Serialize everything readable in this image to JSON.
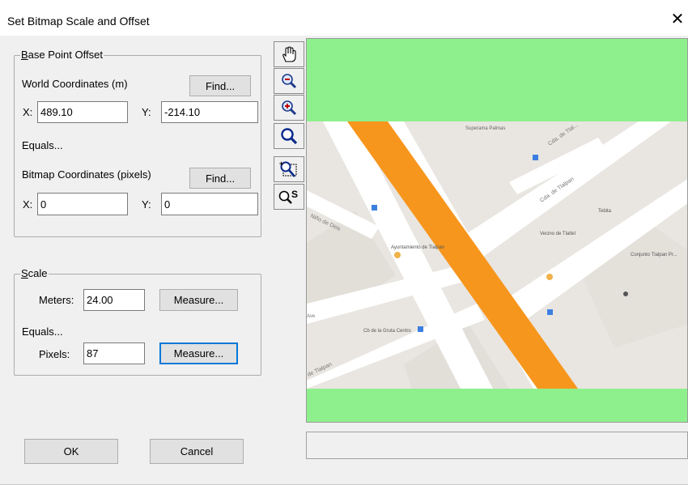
{
  "window": {
    "title": "Set Bitmap Scale and Offset",
    "close_glyph": "✕"
  },
  "base_point_offset": {
    "legend": "Base Point Offset",
    "world_label": "World Coordinates (m)",
    "world_find": "Find...",
    "world_x_label": "X:",
    "world_x_value": "489.10",
    "world_y_label": "Y:",
    "world_y_value": "-214.10",
    "equals": "Equals...",
    "bitmap_label": "Bitmap Coordinates (pixels)",
    "bitmap_find": "Find...",
    "bitmap_x_label": "X:",
    "bitmap_x_value": "0",
    "bitmap_y_label": "Y:",
    "bitmap_y_value": "0"
  },
  "scale": {
    "legend": "Scale",
    "meters_label": "Meters:",
    "meters_value": "24.00",
    "measure_meters": "Measure...",
    "equals": "Equals...",
    "pixels_label": "Pixels:",
    "pixels_value": "87",
    "measure_pixels": "Measure..."
  },
  "buttons": {
    "ok": "OK",
    "cancel": "Cancel"
  },
  "toolbar": {
    "tools": [
      "hand-pan-icon",
      "zoom-out-icon",
      "zoom-in-icon",
      "zoom-fit-icon",
      "zoom-window-icon",
      "zoom-scale-icon"
    ],
    "zoom_scale_letter": "S"
  },
  "map": {
    "labels": {
      "poi_top": "Superama Palmas",
      "street_1": "Cda. de Tlal...",
      "street_2": "Cda. de Tlalpan",
      "shop_1": "Tebita",
      "shop_2": "Vecino de Tlaltel",
      "shop_3": "Conjunto Tlalpan Pr...",
      "poi_left": "Ayuntamiento de Tlalpan",
      "street_left": "Niño de Dios",
      "poi_bottom": "Cb de la Gruta Centro",
      "street_bottom": "de Tlalpan",
      "street_far_left": "Ave"
    },
    "colors": {
      "background": "#8ef08c",
      "highlight": "#f7961d",
      "land": "#e9e6e1",
      "road": "#ffffff"
    }
  }
}
